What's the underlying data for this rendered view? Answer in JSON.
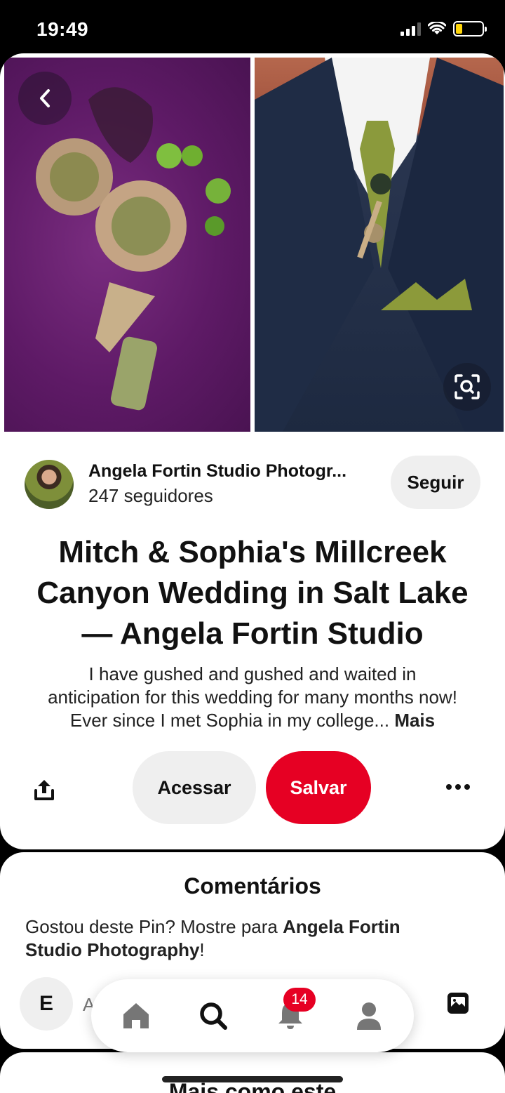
{
  "status_bar": {
    "time": "19:49"
  },
  "creator": {
    "name": "Angela Fortin Studio Photogr...",
    "followers": "247 seguidores",
    "follow_label": "Seguir"
  },
  "pin": {
    "title_lines": [
      "Mitch & Sophia's Millcreek",
      "Canyon Wedding in Salt Lake",
      "— Angela Fortin Studio"
    ],
    "description_lines": [
      "I have gushed and gushed and waited in",
      "anticipation for this wedding for many months now!",
      "Ever since I met Sophia in my college..."
    ],
    "more_label": "Mais"
  },
  "actions": {
    "visit_label": "Acessar",
    "save_label": "Salvar"
  },
  "comments": {
    "title": "Comentários",
    "prompt_prefix": "Gostou deste Pin? Mostre para ",
    "prompt_name_line1": "Angela Fortin",
    "prompt_name_line2": "Studio Photography",
    "prompt_suffix": "!",
    "user_initial": "E",
    "input_placeholder": "A"
  },
  "bottom_nav": {
    "notifications_count": "14"
  },
  "more_like": {
    "title": "Mais como este"
  },
  "colors": {
    "accent": "#e60023",
    "button_gray": "#efefef"
  },
  "icons": [
    "back-icon",
    "visual-search-icon",
    "share-icon",
    "more-icon",
    "photo-icon",
    "home-icon",
    "search-icon",
    "bell-icon",
    "profile-icon"
  ]
}
